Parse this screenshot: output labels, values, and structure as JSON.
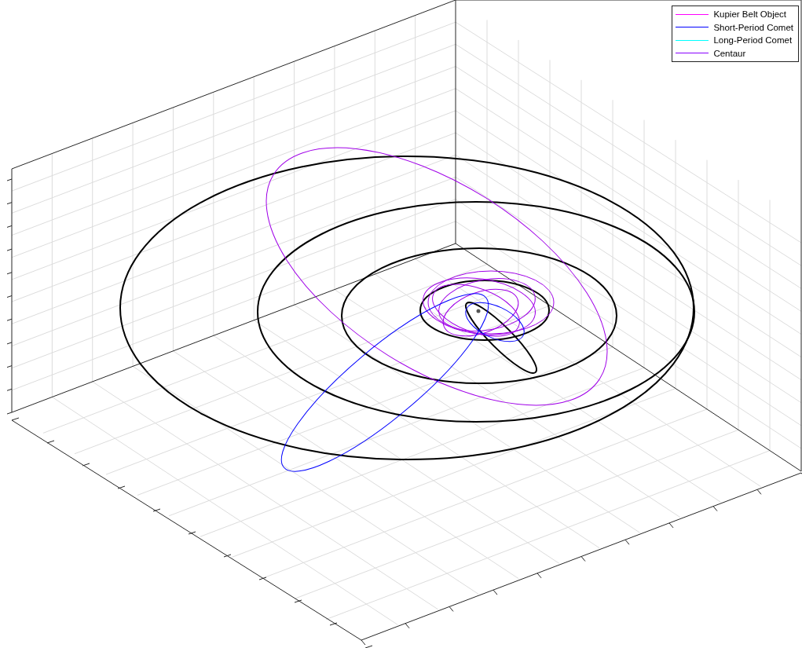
{
  "legend": {
    "items": [
      {
        "label": "Kupier Belt Object",
        "color": "#ff00ff"
      },
      {
        "label": "Short-Period Comet",
        "color": "#0000ff"
      },
      {
        "label": "Long-Period Comet",
        "color": "#00ffff"
      },
      {
        "label": "Centaur",
        "color": "#8800ff"
      }
    ]
  }
}
